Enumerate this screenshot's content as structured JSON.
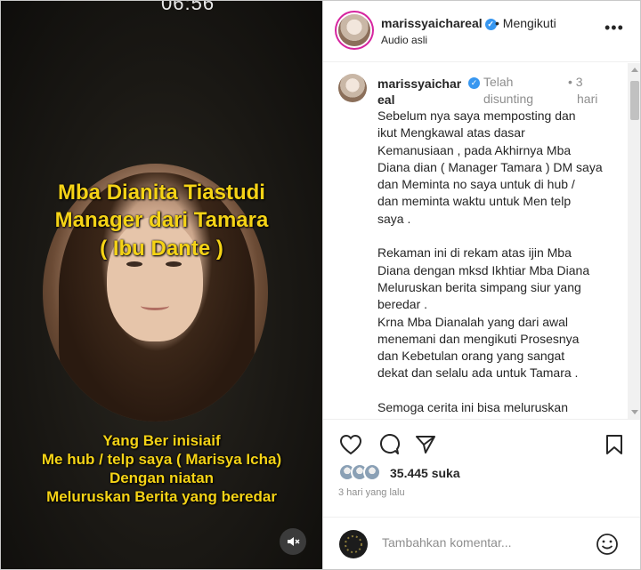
{
  "video": {
    "clock": "06:56",
    "overlay_title_lines": [
      "Mba Dianita Tiastudi",
      "Manager dari Tamara",
      "( Ibu Dante )"
    ],
    "overlay_sub_lines": [
      "Yang Ber inisiaif",
      "Me hub / telp saya ( Marisya Icha)",
      "Dengan niatan",
      "Meluruskan Berita yang beredar"
    ]
  },
  "header": {
    "username": "marissyaichareal",
    "follow_label": "• Mengikuti",
    "audio_label": "Audio asli",
    "more_label": "•••"
  },
  "comment": {
    "username_line1": "marissyaichar",
    "username_line2": "eal",
    "edited_line1": "Telah",
    "edited_line2": "disunting",
    "time_line1": "• 3",
    "time_line2": "hari",
    "caption": "Sebelum nya saya memposting dan\nikut Mengkawal atas dasar\nKemanusiaan , pada Akhirnya Mba\nDiana dian ( Manager Tamara ) DM saya\ndan Meminta no saya untuk di hub /\ndan meminta waktu untuk Men telp\nsaya .\n\nRekaman ini di rekam atas ijin Mba\nDiana dengan mksd Ikhtiar Mba Diana\nMeluruskan berita simpang siur yang\nberedar .\nKrna Mba Dianalah yang dari awal\nmenemani dan mengikuti Prosesnya\ndan Kebetulan orang yang sangat\ndekat dan selalu ada untuk Tamara .\n\nSemoga cerita ini bisa meluruskan"
  },
  "actions": {
    "likes": "35.445 suka",
    "date": "3 hari yang lalu"
  },
  "add_comment": {
    "placeholder": "Tambahkan komentar..."
  },
  "colors": {
    "overlay_text": "#f5d316",
    "verified": "#3897f0",
    "muted_text": "#8e8e8e"
  }
}
